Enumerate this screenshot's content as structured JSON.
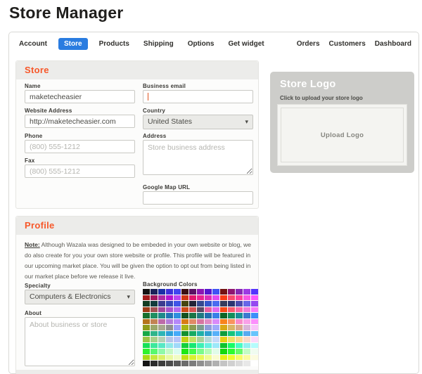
{
  "page_title": "Store Manager",
  "tabs": [
    {
      "label": "Account",
      "active": false
    },
    {
      "label": "Store",
      "active": true
    },
    {
      "label": "Products",
      "active": false
    },
    {
      "label": "Shipping",
      "active": false
    },
    {
      "label": "Options",
      "active": false
    },
    {
      "label": "Get widget",
      "active": false
    }
  ],
  "nav_links": [
    "Orders",
    "Customers",
    "Dashboard"
  ],
  "store": {
    "title": "Store",
    "name": {
      "label": "Name",
      "value": "maketecheasier"
    },
    "business_email": {
      "label": "Business email",
      "value": ""
    },
    "website": {
      "label": "Website Address",
      "value": "http://maketecheasier.com"
    },
    "country": {
      "label": "Country",
      "value": "United States"
    },
    "phone": {
      "label": "Phone",
      "placeholder": "(800) 555-1212"
    },
    "address": {
      "label": "Address",
      "placeholder": "Store business address"
    },
    "fax": {
      "label": "Fax",
      "placeholder": "(800) 555-1212"
    },
    "map_url": {
      "label": "Google Map URL",
      "value": ""
    }
  },
  "profile": {
    "title": "Profile",
    "note_label": "Note:",
    "note_text": " Although Wazala was designed to be embeded in your own website or blog, we do also create for you your own store website or profile. This profile will be featured in our upcoming market place. You will be given the option to opt out from being listed in our market place before we release it live.",
    "specialty": {
      "label": "Specialty",
      "value": "Computers & Electronics"
    },
    "about": {
      "label": "About",
      "placeholder": "About business or store"
    },
    "background_colors": {
      "label": "Background Colors",
      "palette": [
        [
          "#141414",
          "#1b2259",
          "#1b2fa6",
          "#3c31d9",
          "#4245f0",
          "#3c1013",
          "#591263",
          "#8c16b3",
          "#5616d0",
          "#4052f3",
          "#731213",
          "#8f1670",
          "#8629b3",
          "#9c3be3",
          "#5433fc"
        ],
        [
          "#a31c1c",
          "#a3165e",
          "#ad2ba6",
          "#b516d0",
          "#bd45f0",
          "#d03612",
          "#e0166e",
          "#e82294",
          "#db2fb8",
          "#e04af0",
          "#f93c16",
          "#f94a6e",
          "#fc409c",
          "#f957e3",
          "#fc57fc"
        ],
        [
          "#123c21",
          "#123c3c",
          "#3c3c8f",
          "#3548b6",
          "#4054e8",
          "#45450f",
          "#232336",
          "#35488f",
          "#3554cc",
          "#4a6bf0",
          "#363c5c",
          "#2b3570",
          "#4a4aad",
          "#6666e8",
          "#9448f0"
        ],
        [
          "#9c3c16",
          "#a35353",
          "#a3489c",
          "#a853cc",
          "#b069f0",
          "#cc4a16",
          "#d65353",
          "#5c4a66",
          "#e85ea3",
          "#e069f0",
          "#f94a16",
          "#f95c6e",
          "#f969a8",
          "#f07cdb",
          "#f97cf9"
        ],
        [
          "#16702e",
          "#1f8f62",
          "#1f8a8a",
          "#2375b6",
          "#2e8fdf",
          "#135220",
          "#197546",
          "#1f7a80",
          "#236fb0",
          "#3880e8",
          "#0e6627",
          "#138f5b",
          "#198f99",
          "#3c7ad0",
          "#3c8ff9"
        ],
        [
          "#b5741c",
          "#c28353",
          "#bd6ba8",
          "#b37cd9",
          "#b588f9",
          "#d97c16",
          "#e08a66",
          "#d676a1",
          "#e08ac4",
          "#d98af9",
          "#f9831c",
          "#f9945e",
          "#f98ac9",
          "#f9a0e8",
          "#fc8ffc"
        ],
        [
          "#8f9c1c",
          "#9ca86b",
          "#a8a88f",
          "#8f8f8f",
          "#9c9cf9",
          "#a8b516",
          "#8a9c53",
          "#7c9c8f",
          "#8f9cd9",
          "#a0aaf9",
          "#d9a816",
          "#d9b566",
          "#d9a88f",
          "#d9b5d9",
          "#f9c4f9"
        ],
        [
          "#16a846",
          "#2eb58a",
          "#2eb5b5",
          "#2ea0d9",
          "#46aaf9",
          "#13902e",
          "#16aa62",
          "#1fb0a8",
          "#2ea0d0",
          "#57b0f9",
          "#0f9c3c",
          "#16c47c",
          "#1fc4c4",
          "#57aaf0",
          "#66c4fc"
        ],
        [
          "#9cc446",
          "#a8d08a",
          "#b5d0b5",
          "#b5c4e8",
          "#b5c4f9",
          "#c4d016",
          "#c4e066",
          "#aad09c",
          "#b5d9d9",
          "#c4d9f9",
          "#e8d016",
          "#f0e066",
          "#f9d990",
          "#f9d9c9",
          "#fcd9f9"
        ],
        [
          "#16e057",
          "#3ce89c",
          "#57e8c4",
          "#8fe8e8",
          "#a0d9f9",
          "#13d03c",
          "#16e873",
          "#3cf0b5",
          "#66f0e0",
          "#9ce8f9",
          "#0fc42e",
          "#16fc66",
          "#46fcc4",
          "#90f0f0",
          "#b5fcfc"
        ],
        [
          "#2ef22e",
          "#57f96e",
          "#8ff9a8",
          "#c4f9c4",
          "#d9fcf0",
          "#1fe816",
          "#46fc46",
          "#7cfc8a",
          "#b5fcb5",
          "#e0fce8",
          "#16d90e",
          "#2efc2e",
          "#66fc66",
          "#c4fcc4",
          "#f0fcf0"
        ],
        [
          "#a8d916",
          "#c4e83c",
          "#d9f066",
          "#e8f9a0",
          "#f0fcc4",
          "#c4e016",
          "#d9f02e",
          "#e8f957",
          "#f0fc90",
          "#f9fcd0",
          "#e8f016",
          "#f0fc2e",
          "#f9fc66",
          "#fcfca0",
          "#fcfce0"
        ],
        [
          "#141414",
          "#2b2b2b",
          "#3c3c3c",
          "#4a4a4a",
          "#595959",
          "#6b6b6b",
          "#7c7c7c",
          "#8f8f8f",
          "#a0a0a0",
          "#b0b0b0",
          "#c4c4c4",
          "#d0d0d0",
          "#dbdbdb",
          "#e8e8e8",
          "#ffffff"
        ]
      ]
    }
  },
  "logo_panel": {
    "title": "Store Logo",
    "hint": "Click to upload your store logo",
    "upload_label": "Upload Logo"
  },
  "theme": {
    "accent_orange": "#f7582a",
    "tab_active_blue": "#2a7ce0",
    "logo_panel_bg": "#cdcdca"
  }
}
